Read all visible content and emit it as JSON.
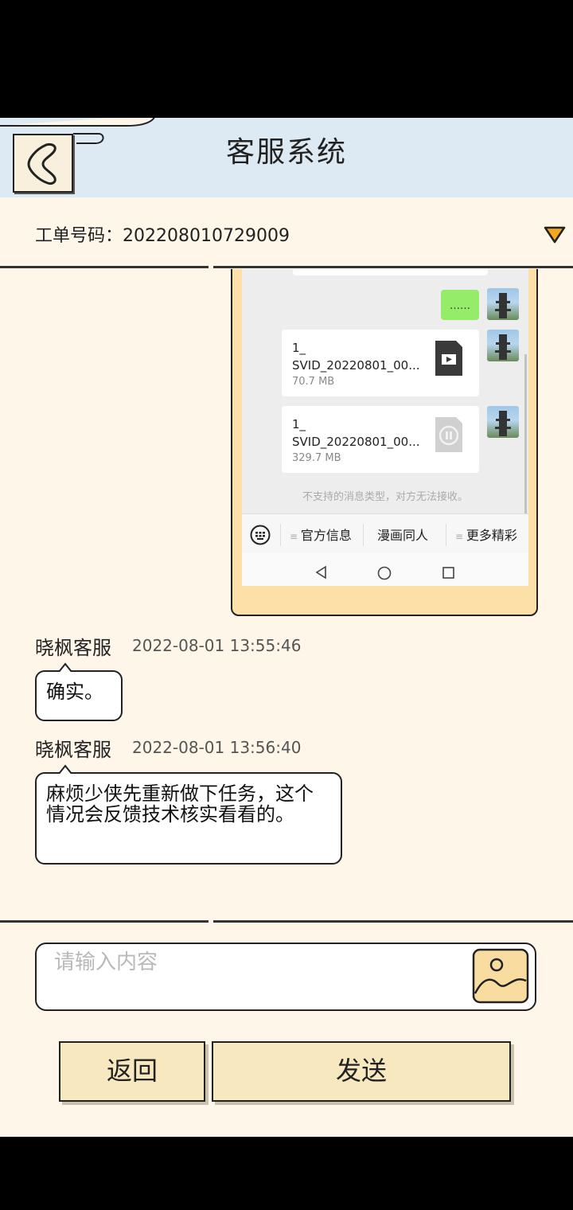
{
  "header": {
    "title": "客服系统"
  },
  "ticket": {
    "label": "工单号码：",
    "number": "202208010729009"
  },
  "screenshot": {
    "green_bubble": "……",
    "files": [
      {
        "prefix": "1_",
        "name": "SVID_20220801_00...",
        "size": "70.7 MB"
      },
      {
        "prefix": "1_",
        "name": "SVID_20220801_00...",
        "size": "329.7 MB"
      }
    ],
    "note": "不支持的消息类型，对方无法接收。",
    "menu": [
      "官方信息",
      "漫画同人",
      "更多精彩"
    ]
  },
  "messages": [
    {
      "sender": "晓枫客服",
      "time": "2022-08-01 13:55:46",
      "text": "确实。"
    },
    {
      "sender": "晓枫客服",
      "time": "2022-08-01 13:56:40",
      "text": "麻烦少侠先重新做下任务，这个情况会反馈技术核实看看的。"
    }
  ],
  "input": {
    "placeholder": "请输入内容"
  },
  "buttons": {
    "back": "返回",
    "send": "发送"
  },
  "colors": {
    "header_bg": "#dde9f3",
    "page_bg": "#fdf6e9",
    "button_bg": "#f8e8c0",
    "accent": "#f5a623"
  }
}
